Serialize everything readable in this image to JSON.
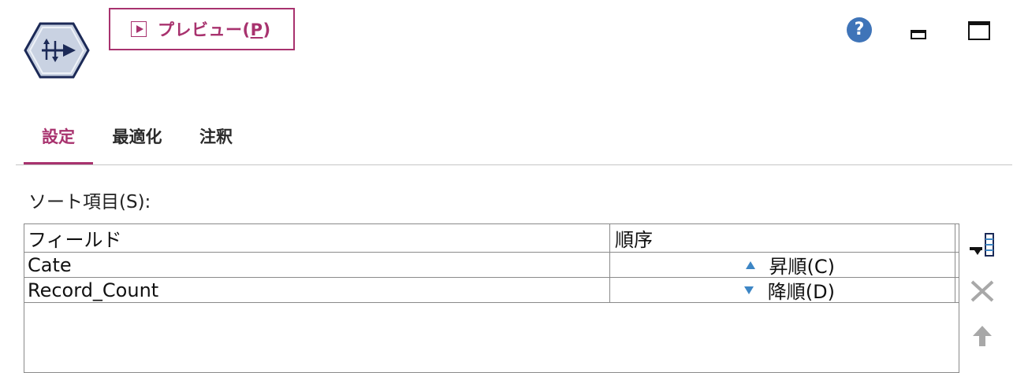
{
  "toolbar": {
    "preview_label": "プレビュー(",
    "preview_mnemonic": "P",
    "preview_close": ")",
    "help_glyph": "?"
  },
  "tabs": [
    {
      "label": "設定",
      "active": true
    },
    {
      "label": "最適化",
      "active": false
    },
    {
      "label": "注釈",
      "active": false
    }
  ],
  "sort": {
    "label": "ソート項目(S):",
    "columns": {
      "field": "フィールド",
      "order": "順序"
    },
    "rows": [
      {
        "field": "Cate",
        "order": "昇順(C)",
        "direction": "up"
      },
      {
        "field": "Record_Count",
        "order": "降順(D)",
        "direction": "down"
      }
    ]
  },
  "colors": {
    "accent": "#a8326e",
    "help_blue": "#3f74b8",
    "sort_arrow": "#3d86c5",
    "node_icon_fill": "#c9d2e2"
  }
}
